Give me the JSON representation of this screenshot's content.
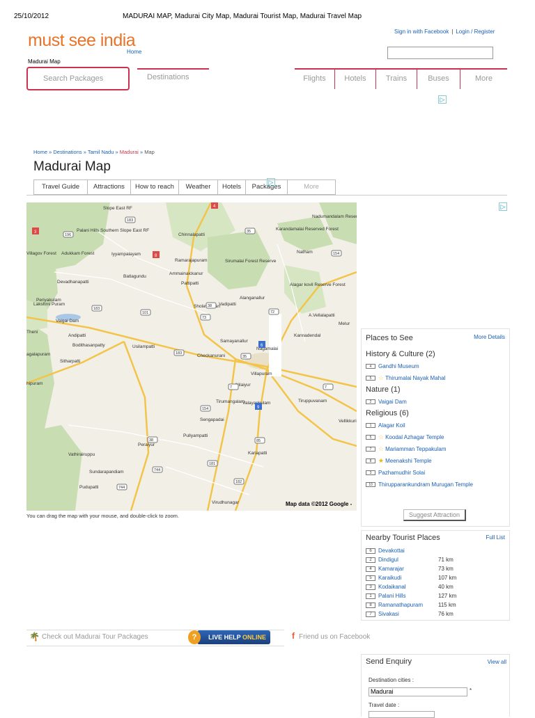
{
  "print_header": {
    "date": "25/10/2012",
    "title": "MADURAI MAP, Madurai City Map, Madurai Tourist Map, Madurai Travel Map"
  },
  "brand": {
    "logo": "must see india",
    "home": "Home"
  },
  "top_links": {
    "facebook": "Sign in with Facebook",
    "sep": "|",
    "login": "Login / Register"
  },
  "small_crumb": "Madurai Map",
  "nav": {
    "search_packages": "Search Packages",
    "destinations": "Destinations",
    "tabs": [
      "Flights",
      "Hotels",
      "Trains",
      "Buses",
      "More"
    ]
  },
  "breadcrumb": {
    "home": "Home",
    "destinations": "Destinations",
    "state": "Tamil Nadu",
    "city": "Madurai",
    "page": "Map",
    "sep": "»"
  },
  "page_title": "Madurai Map",
  "subtabs": [
    "Travel Guide",
    "Attractions",
    "How to reach",
    "Weather",
    "Hotels",
    "Packages",
    "More"
  ],
  "map": {
    "credit": "Map data ©2012 Google -",
    "caption": "You can drag the map with your mouse, and double-click to zoom.",
    "labels": [
      {
        "t": "Slope East RF"
      },
      {
        "t": "Palani Hills Southern Slope East RF"
      },
      {
        "t": "Chinnalapatti"
      },
      {
        "t": "Karandamalai Reserved Forest"
      },
      {
        "t": "Nadumandalam Reserved Forest"
      },
      {
        "t": "Iyyampalayam"
      },
      {
        "t": "Adukkam Forest"
      },
      {
        "t": "Villagov Forest"
      },
      {
        "t": "Ramarajapuram"
      },
      {
        "t": "Ammainaickanur"
      },
      {
        "t": "Sirumalai Forest Reserve"
      },
      {
        "t": "Natham"
      },
      {
        "t": "Batlagundu"
      },
      {
        "t": "Pattipatti"
      },
      {
        "t": "Devadhanapatti"
      },
      {
        "t": "Periyakulam"
      },
      {
        "t": "Alagar kovil Reserve Forest"
      },
      {
        "t": "Lakshmi Puram"
      },
      {
        "t": "Vaigai Dam"
      },
      {
        "t": "Vadipatti"
      },
      {
        "t": "Alanganallur"
      },
      {
        "t": "A.Vellalapatti"
      },
      {
        "t": "Sholavandan"
      },
      {
        "t": "Melur"
      },
      {
        "t": "Theni"
      },
      {
        "t": "Andipatti"
      },
      {
        "t": "Kannadendal"
      },
      {
        "t": "Samayanallur"
      },
      {
        "t": "Bodithasanpatty"
      },
      {
        "t": "Usilampatti"
      },
      {
        "t": "Checkanurani"
      },
      {
        "t": "agalapuram"
      },
      {
        "t": "Sitharpatti"
      },
      {
        "t": "Nagamalai"
      },
      {
        "t": "Villapuram"
      },
      {
        "t": "hipuram"
      },
      {
        "t": "Nilaiyur"
      },
      {
        "t": "Tirumangalam"
      },
      {
        "t": "Valayankulam"
      },
      {
        "t": "Tiruppuvanam"
      },
      {
        "t": "Sengapadai"
      },
      {
        "t": "Vellikkurichi"
      },
      {
        "t": "Peraiyur"
      },
      {
        "t": "Pullyampatti"
      },
      {
        "t": "Vathirairuppu"
      },
      {
        "t": "Kariapatti"
      },
      {
        "t": "Sundarapandiam"
      },
      {
        "t": "Pudupatti"
      },
      {
        "t": "Virudhunagar"
      }
    ],
    "highways": [
      "196",
      "183",
      "35",
      "38",
      "154",
      "101",
      "183",
      "73",
      "72",
      "35",
      "183",
      "85",
      "7",
      "7",
      "85",
      "38",
      "154",
      "744",
      "182",
      "181",
      "744"
    ],
    "markers": [
      "4",
      "3",
      "8",
      "6",
      "9"
    ]
  },
  "places": {
    "title": "Places to See",
    "more": "More Details",
    "categories": [
      {
        "name": "History & Culture (2)",
        "items": [
          {
            "n": "4",
            "star": false,
            "label": "Gandhi Museum"
          },
          {
            "n": "5",
            "star": "o",
            "label": "Thirumalai Nayak Mahal"
          }
        ]
      },
      {
        "name": "Nature (1)",
        "items": [
          {
            "n": "2",
            "star": false,
            "label": "Vaigai Dam"
          }
        ]
      },
      {
        "name": "Religious (6)",
        "items": [
          {
            "n": "1",
            "star": false,
            "label": "Alagar Koil"
          },
          {
            "n": "5",
            "star": "o",
            "label": "Koodal Azhagar Temple"
          },
          {
            "n": "7",
            "star": "o",
            "label": "Mariamman Teppakulam"
          },
          {
            "n": "8",
            "star": "f",
            "label": "Meenakshi Temple"
          },
          {
            "n": "3",
            "star": false,
            "label": "Pazhamudhir Solai"
          },
          {
            "n": "10",
            "star": false,
            "label": "Thirupparankundram Murugan Temple"
          }
        ]
      }
    ],
    "suggest": "Suggest Attraction"
  },
  "nearby": {
    "title": "Nearby Tourist Places",
    "full": "Full List",
    "rows": [
      {
        "n": "6",
        "name": "Devakottai",
        "km": ""
      },
      {
        "n": "2",
        "name": "Dindigul",
        "km": "71 km"
      },
      {
        "n": "4",
        "name": "Kamarajar",
        "km": "73 km"
      },
      {
        "n": "5",
        "name": "Karaikudi",
        "km": "107 km"
      },
      {
        "n": "3",
        "name": "Kodaikanal",
        "km": "40 km"
      },
      {
        "n": "1",
        "name": "Palani Hills",
        "km": "127 km"
      },
      {
        "n": "8",
        "name": "Ramanathapuram",
        "km": "115 km"
      },
      {
        "n": "7",
        "name": "Sivakasi",
        "km": "76 km"
      }
    ]
  },
  "bottom": {
    "tour": "Check out Madurai Tour Packages",
    "live_help": "LIVE HELP",
    "online": "ONLINE",
    "friend": "Friend us on Facebook"
  },
  "enquiry": {
    "title": "Send Enquiry",
    "view_all": "View all",
    "dest_label": "Destination cities :",
    "dest_value": "Madurai",
    "req": "*",
    "date_label": "Travel date :"
  },
  "colors": {
    "accent": "#c8344f",
    "logo": "#e8742a",
    "link": "#1a5fb4"
  }
}
